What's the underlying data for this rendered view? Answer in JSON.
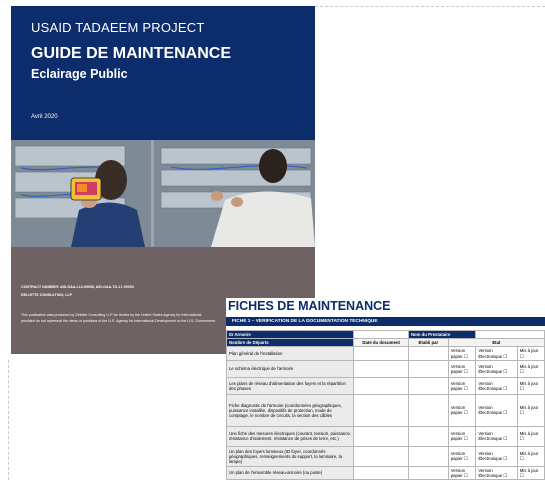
{
  "cover": {
    "project": "USAID TADAEEM PROJECT",
    "title": "GUIDE DE MAINTENANCE",
    "subtitle": "Eclairage Public",
    "date": "Avril 2020",
    "contract": "CONTRACT NUMBER: AID-OAA-I-14-00006, AID-OAA-TO-17-00003",
    "company": "DELOITTE CONSULTING, LLP",
    "disclaimer_1": "This publication was produced by Deloitte Consulting LLP for review by the United States Agency for International",
    "disclaimer_2": "provided do not represent the views or positions of the U.S. Agency for International Development or the U.S. Government."
  },
  "sheet": {
    "title": "FICHES DE MAINTENANCE",
    "section": "FICHE 1 – VERIFICATION DE LA DOCUMENTATION TECHNIQUE",
    "id_label": "ID Armoire",
    "prestataire_label": "Nom du Prestataire",
    "departs_label": "Nombre de Départs",
    "col_date": "Date du document",
    "col_etabli": "Établi par",
    "col_etat": "Etat",
    "rows": [
      {
        "label": "Plan général de l'installation",
        "v1": "Version papier ☐",
        "v2": "Version Électronique ☐",
        "v3": "Mis à jour ☐"
      },
      {
        "label": "Le schéma électrique de l'armoire",
        "v1": "Version papier ☐",
        "v2": "Version Électronique ☐",
        "v3": "Mis à jour ☐"
      },
      {
        "label": "Les plans de réseau d'alimentation des foyers et la répartition des phases",
        "v1": "Version papier ☐",
        "v2": "Version Électronique ☐",
        "v3": "Mis à jour ☐"
      },
      {
        "label": "Fiche diagnostic de l'armoire (coordonnées géographiques, puissance installée, dispositifs de protection, mode de comptage, le nombre de circuits, la section des câbles",
        "v1": "Version papier ☐",
        "v2": "Version Électronique ☐",
        "v3": "Mis à jour ☐"
      },
      {
        "label": "Une fiche des mesures électriques (courant, tension, puissance, résistance d'isolement, résistance de prises de terre, etc.)",
        "v1": "Version papier ☐",
        "v2": "Version Électronique ☐",
        "v3": "Mis à jour ☐"
      },
      {
        "label": "Un plan des foyers lumineux (ID foyer, coordonnés géographiques, renseignements du support, la luminaire, la lampe)",
        "v1": "Version papier ☐",
        "v2": "Version Électronique ☐",
        "v3": "Mis à jour ☐"
      },
      {
        "label": "Un plan de l'ensemble réseau-armoire (ou poste)",
        "v1": "Version papier ☐",
        "v2": "Version Électronique ☐",
        "v3": "Mis à jour ☐"
      }
    ]
  }
}
